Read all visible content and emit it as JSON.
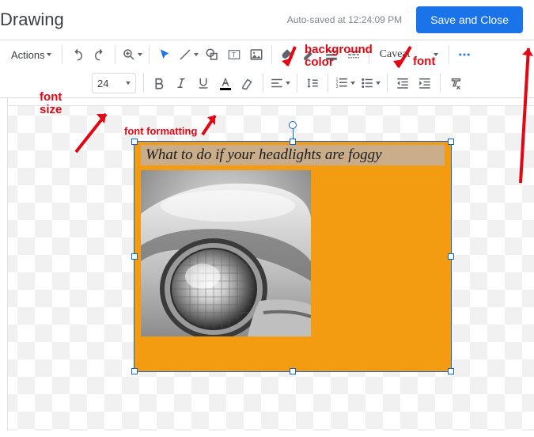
{
  "header": {
    "title": "Drawing",
    "autosave": "Auto-saved at 12:24:09 PM",
    "save_close": "Save and Close"
  },
  "toolbar1": {
    "actions": "Actions",
    "font_name": "Caveat"
  },
  "toolbar2": {
    "font_size": "24"
  },
  "shape": {
    "title_text": "What to do if your headlights are foggy"
  },
  "annotations": {
    "bg_color": "background\ncolor",
    "font": "font",
    "font_size": "font\nsize",
    "font_formatting": "font formatting"
  }
}
